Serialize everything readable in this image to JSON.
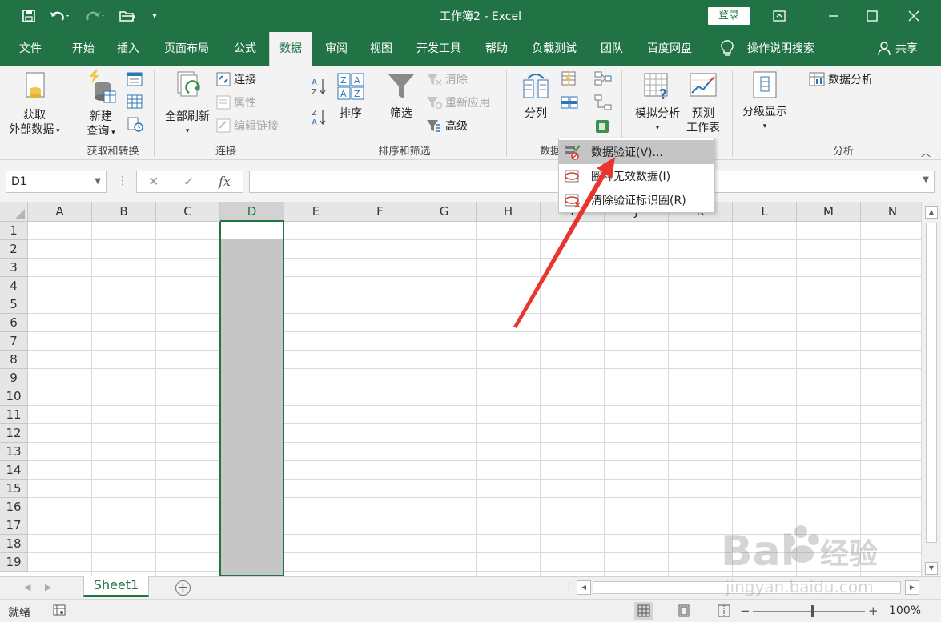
{
  "window": {
    "title": "工作簿2 - Excel",
    "login_label": "登录"
  },
  "tabs": [
    {
      "label": "文件"
    },
    {
      "label": "开始"
    },
    {
      "label": "插入"
    },
    {
      "label": "页面布局"
    },
    {
      "label": "公式"
    },
    {
      "label": "数据",
      "active": true
    },
    {
      "label": "审阅"
    },
    {
      "label": "视图"
    },
    {
      "label": "开发工具"
    },
    {
      "label": "帮助"
    },
    {
      "label": "负载测试"
    },
    {
      "label": "团队"
    },
    {
      "label": "百度网盘"
    },
    {
      "label": "操作说明搜索"
    },
    {
      "label": "共享"
    }
  ],
  "ribbon": {
    "get_external": {
      "line1": "获取",
      "line2": "外部数据"
    },
    "new_query": {
      "line1": "新建",
      "line2": "查询"
    },
    "group_get_transform": "获取和转换",
    "refresh_all": "全部刷新",
    "connections": "连接",
    "properties": "属性",
    "edit_links": "编辑链接",
    "group_connections": "连接",
    "sort": "排序",
    "filter": "筛选",
    "clear": "清除",
    "reapply": "重新应用",
    "advanced": "高级",
    "group_sort_filter": "排序和筛选",
    "text_to_columns": "分列",
    "group_data_tools": "数据",
    "what_if": "模拟分析",
    "forecast": {
      "line1": "预测",
      "line2": "工作表"
    },
    "outline": "分级显示",
    "data_analysis": "数据分析",
    "group_analysis": "分析"
  },
  "dv_menu": {
    "items": [
      {
        "label": "数据验证(V)...",
        "highlighted": true
      },
      {
        "label": "圈释无效数据(I)"
      },
      {
        "label": "清除验证标识圈(R)"
      }
    ]
  },
  "formula_bar": {
    "name_box": "D1",
    "fx": "fx"
  },
  "grid": {
    "columns": [
      "A",
      "B",
      "C",
      "D",
      "E",
      "F",
      "G",
      "H",
      "I",
      "J",
      "K",
      "L",
      "M",
      "N"
    ],
    "rows": [
      "1",
      "2",
      "3",
      "4",
      "5",
      "6",
      "7",
      "8",
      "9",
      "10",
      "11",
      "12",
      "13",
      "14",
      "15",
      "16",
      "17",
      "18",
      "19"
    ],
    "selected_column": "D",
    "active_cell": "D1"
  },
  "sheets": [
    {
      "label": "Sheet1",
      "active": true
    }
  ],
  "status": {
    "ready": "就绪",
    "zoom": "100%"
  },
  "watermark": {
    "brand": "Bai",
    "brand_cn": "经验",
    "url": "jingyan.baidu.com"
  },
  "colors": {
    "excel_green": "#217346",
    "annotation_red": "#e8352e"
  }
}
